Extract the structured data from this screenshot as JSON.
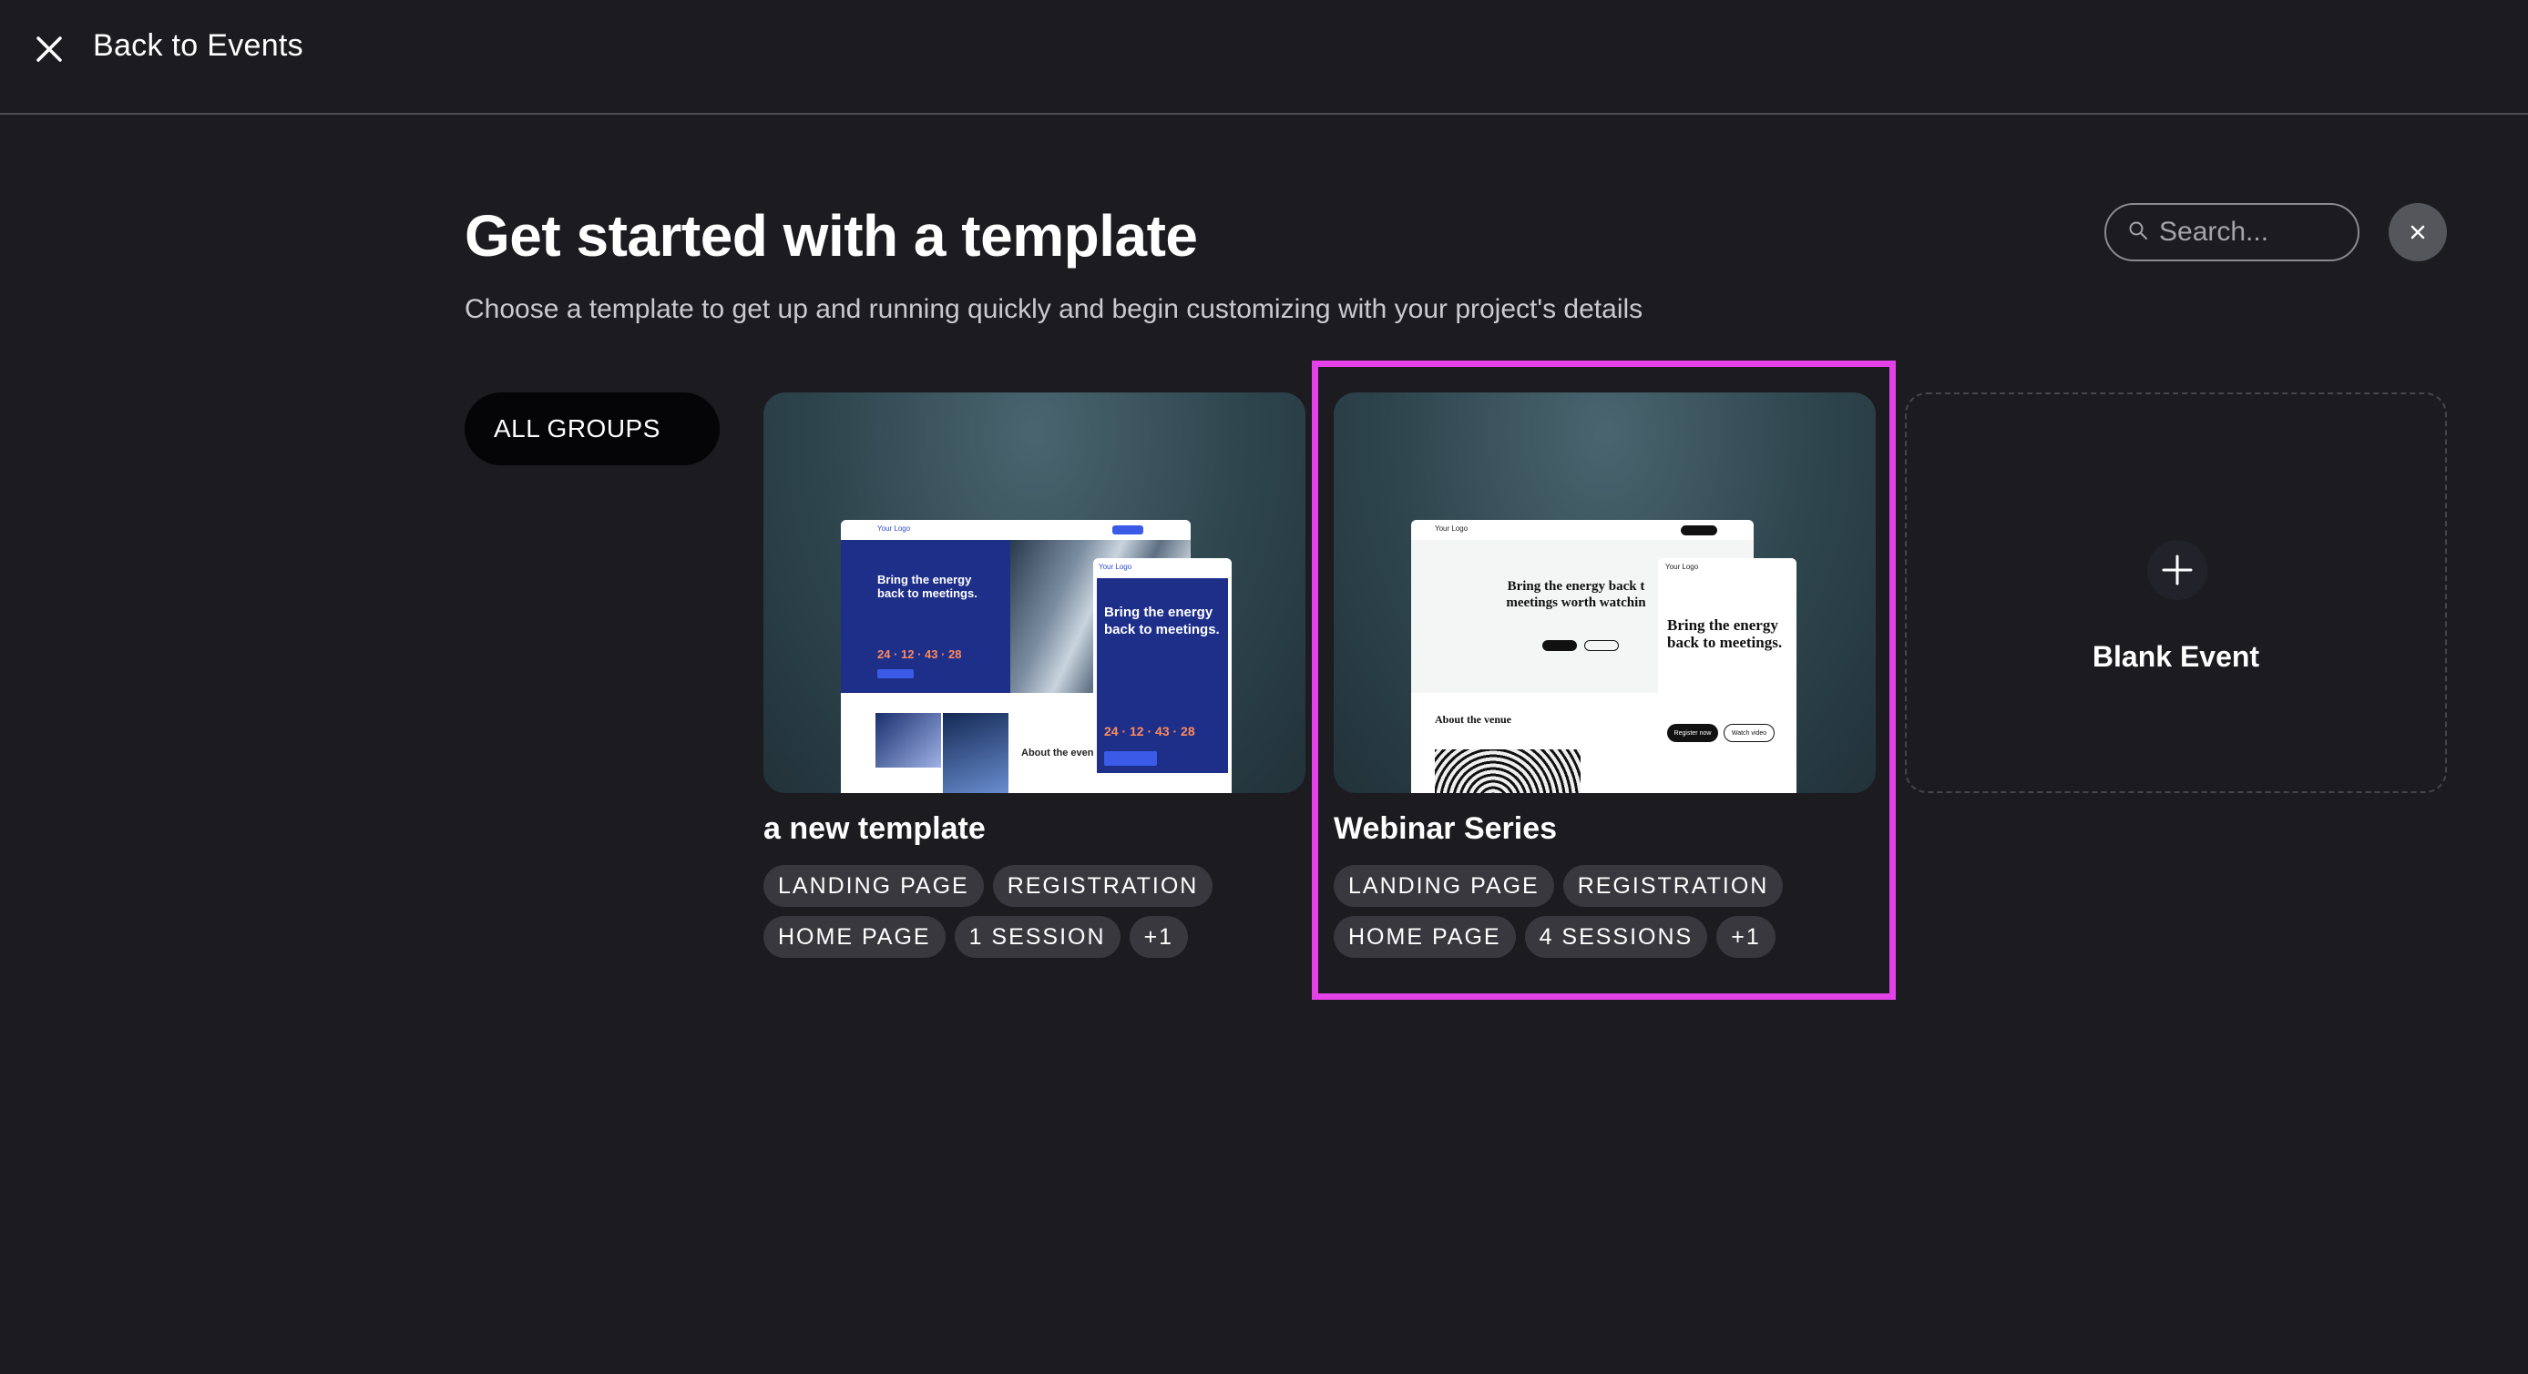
{
  "topbar": {
    "back_label": "Back to Events",
    "close_icon": "close-icon"
  },
  "header": {
    "title": "Get started with a template",
    "subtitle": "Choose a template to get up and running quickly and begin customizing with your project's details"
  },
  "search": {
    "placeholder": "Search...",
    "value": "",
    "icon": "search-icon",
    "clear_icon": "close-icon"
  },
  "filters": {
    "selected_group": "ALL GROUPS"
  },
  "templates": [
    {
      "title": "a new template",
      "tags": [
        "LANDING PAGE",
        "REGISTRATION",
        "HOME PAGE",
        "1 SESSION",
        "+1"
      ],
      "preview": {
        "logo": "Your Logo",
        "headline_desktop": "Bring the energy back to meetings.",
        "headline_mobile": "Bring the energy back to meetings.",
        "countdown": "24 · 12 · 43 · 28",
        "section": "About the even",
        "accent": "#1e2f8a"
      }
    },
    {
      "title": "Webinar Series",
      "tags": [
        "LANDING PAGE",
        "REGISTRATION",
        "HOME PAGE",
        "4 SESSIONS",
        "+1"
      ],
      "preview": {
        "logo": "Your Logo",
        "headline_desktop": "Bring the energy back t meetings worth watchin",
        "headline_mobile": "Bring the energy back to meetings.",
        "section": "About the venue",
        "button_primary": "Register now",
        "button_secondary": "Watch video"
      },
      "highlighted": true
    }
  ],
  "blank": {
    "label": "Blank Event",
    "icon": "plus-icon"
  },
  "colors": {
    "background": "#1b1b20",
    "highlight": "#e442e8",
    "tag_bg": "#38383e"
  }
}
